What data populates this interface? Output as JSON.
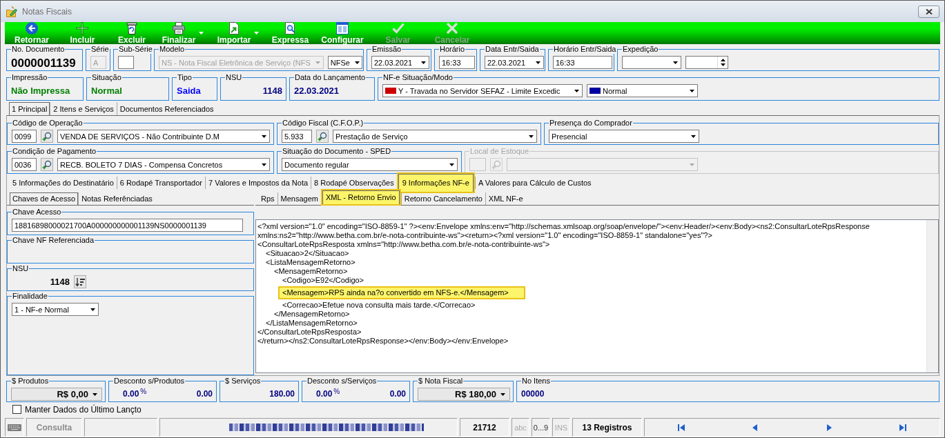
{
  "window": {
    "title": "Notas Fiscais"
  },
  "toolbar": [
    {
      "label": "Retornar",
      "kind": "back",
      "disabled": false,
      "dropdown": false
    },
    {
      "label": "Incluir",
      "kind": "add",
      "disabled": false,
      "dropdown": false
    },
    {
      "label": "Excluir",
      "kind": "delete",
      "disabled": false,
      "dropdown": false
    },
    {
      "label": "Finalizar",
      "kind": "print",
      "disabled": false,
      "dropdown": true
    },
    {
      "label": "Importar",
      "kind": "import",
      "disabled": false,
      "dropdown": true
    },
    {
      "label": "Expressa",
      "kind": "preview",
      "disabled": false,
      "dropdown": false
    },
    {
      "label": "Configurar",
      "kind": "configure",
      "disabled": false,
      "dropdown": false
    },
    {
      "label": "Salvar",
      "kind": "save",
      "disabled": true,
      "dropdown": false
    },
    {
      "label": "Cancelar",
      "kind": "cancel",
      "disabled": true,
      "dropdown": false
    }
  ],
  "header": [
    {
      "label": "No. Documento",
      "fields": [
        {
          "kind": "number",
          "value": "0000001139"
        }
      ]
    },
    {
      "label": "Série",
      "fields": [
        {
          "kind": "input",
          "value": "A",
          "disabled": true
        }
      ]
    },
    {
      "label": "Sub-Série",
      "fields": [
        {
          "kind": "input",
          "disabled": false
        }
      ]
    },
    {
      "label": "Modelo",
      "fields": [
        {
          "kind": "select",
          "value": "NS - Nota Fiscal Eletrônica de Serviço (NFS",
          "disabled": true
        },
        {
          "kind": "select",
          "value": "NFSe",
          "disabled": false
        }
      ]
    },
    {
      "label": "Emissão",
      "fields": [
        {
          "kind": "date",
          "value": "22.03.2021"
        }
      ]
    },
    {
      "label": "Horário",
      "fields": [
        {
          "kind": "input",
          "value": "16:33",
          "disabled": false
        }
      ]
    },
    {
      "label": "Data Entr/Saida",
      "fields": [
        {
          "kind": "date",
          "value": "22.03.2021"
        }
      ]
    },
    {
      "label": "Horário Entr/Saida",
      "fields": [
        {
          "kind": "input",
          "value": "16:33",
          "disabled": false
        }
      ]
    },
    {
      "label": "Expedição",
      "fields": [
        {
          "kind": "select",
          "disabled": false
        },
        {
          "kind": "spin"
        }
      ]
    }
  ],
  "info": [
    {
      "label": "Impressão",
      "fields": [
        {
          "kind": "status",
          "value": "Não Impressa",
          "color": "#008000"
        }
      ]
    },
    {
      "label": "Situação",
      "fields": [
        {
          "kind": "status",
          "value": "Normal",
          "color": "#008000"
        }
      ]
    },
    {
      "label": "Tipo",
      "fields": [
        {
          "kind": "status",
          "value": "Saida",
          "color": "#0000ff"
        }
      ]
    },
    {
      "label": "NSU",
      "fields": [
        {
          "kind": "status",
          "value": "1148",
          "color": "#000080"
        }
      ]
    },
    {
      "label": "Data do Lançamento",
      "fields": [
        {
          "kind": "status",
          "value": "22.03.2021",
          "color": "#000080"
        }
      ]
    },
    {
      "label": "NF-e Situação/Modo",
      "fields": [
        {
          "kind": "flag_select",
          "value": "Y - Travada no Servidor SEFAZ - Limite Excedic",
          "color": "#cc0000"
        },
        {
          "kind": "flag_select",
          "value": "Normal",
          "color": "#0000a0"
        }
      ]
    }
  ],
  "main_tabs": [
    {
      "label": "1 Principal",
      "selected": true
    },
    {
      "label": "2 Itens e Serviços",
      "selected": false
    },
    {
      "label": "Documentos Referenciados",
      "selected": false
    }
  ],
  "principal": [
    [
      {
        "label": "Código de Operação",
        "disabled": false,
        "fields": [
          {
            "kind": "input",
            "value": "0099",
            "disabled": false
          },
          {
            "kind": "search_button",
            "disabled": false
          },
          {
            "kind": "select",
            "value": "VENDA DE SERVIÇOS - Não Contribuinte D.M",
            "disabled": false
          }
        ]
      },
      {
        "label": "Código Fiscal (C.F.O.P.)",
        "disabled": false,
        "fields": [
          {
            "kind": "input",
            "value": "5.933",
            "disabled": false
          },
          {
            "kind": "search_button",
            "disabled": false
          },
          {
            "kind": "select",
            "value": "Prestação de Serviço",
            "disabled": false
          }
        ]
      },
      {
        "label": "Presença do Comprador",
        "disabled": false,
        "fields": [
          {
            "kind": "select",
            "value": "Presencial",
            "disabled": false
          }
        ]
      }
    ],
    [
      {
        "label": "Condição de Pagamento",
        "disabled": false,
        "fields": [
          {
            "kind": "input",
            "value": "0036",
            "disabled": false
          },
          {
            "kind": "search_button",
            "disabled": false
          },
          {
            "kind": "select",
            "value": "RECB. BOLETO 7 DIAS - Compensa Concretos",
            "disabled": false
          }
        ]
      },
      {
        "label": "Situação do Documento - SPED",
        "disabled": false,
        "fields": [
          {
            "kind": "select",
            "value": "Documento regular",
            "disabled": false
          }
        ]
      },
      {
        "label": "Local de Estoque",
        "disabled": true,
        "fields": [
          {
            "kind": "input",
            "disabled": true
          },
          {
            "kind": "search_button",
            "disabled": true
          },
          {
            "kind": "select",
            "disabled": true
          }
        ]
      }
    ]
  ],
  "sub_tabs": [
    {
      "label": "5 Informações do Destinatário",
      "selected": false,
      "highlighted": false
    },
    {
      "label": "6 Rodapé Transportador",
      "selected": false,
      "highlighted": false
    },
    {
      "label": "7 Valores e Impostos da Nota",
      "selected": false,
      "highlighted": false
    },
    {
      "label": "8 Rodapé Observações",
      "selected": false,
      "highlighted": false
    },
    {
      "label": "9 Informações NF-e",
      "selected": true,
      "highlighted": true
    },
    {
      "label": "A Valores para Cálculo de Custos",
      "selected": false,
      "highlighted": false
    }
  ],
  "detail": {
    "tabs": [
      {
        "label": "Chaves de Acesso",
        "selected": true
      },
      {
        "label": "Notas Referênciadas",
        "selected": false
      }
    ],
    "groups": [
      {
        "label": "Chave Acesso",
        "fields": [
          {
            "kind": "input",
            "value": "18816898000021700A000000000001139NS0000001139",
            "disabled": false
          }
        ]
      },
      {
        "label": "Chave NF Referenciada"
      },
      {
        "label": "NSU",
        "fields": [
          {
            "kind": "value",
            "value": "1148"
          },
          {
            "kind": "sort_button"
          }
        ]
      },
      {
        "label": "Finalidade",
        "fields": [
          {
            "kind": "select",
            "value": "1 - NF-e Normal",
            "disabled": false
          }
        ]
      }
    ]
  },
  "xml": {
    "tabs": [
      {
        "label": "Rps",
        "selected": false,
        "highlighted": false
      },
      {
        "label": "Mensagem",
        "selected": false,
        "highlighted": false
      },
      {
        "label": "XML - Retorno Envio",
        "selected": true,
        "highlighted": true
      },
      {
        "label": "Retorno Cancelamento",
        "selected": false,
        "highlighted": false
      },
      {
        "label": "XML NF-e",
        "selected": false,
        "highlighted": false
      }
    ],
    "lines": [
      {
        "text": "<?xml version=\"1.0\" encoding=\"ISO-8859-1\" ?><env:Envelope xmlns:env=\"http://schemas.xmlsoap.org/soap/envelope/\"><env:Header/><env:Body><ns2:ConsultarLoteRpsResponse",
        "highlighted": false
      },
      {
        "text": "xmlns:ns2=\"http://www.betha.com.br/e-nota-contribuinte-ws\"><return><?xml version=\"1.0\" encoding=\"ISO-8859-1\" standalone=\"yes\"?>",
        "highlighted": false
      },
      {
        "text": "<ConsultarLoteRpsResposta xmlns=\"http://www.betha.com.br/e-nota-contribuinte-ws\">",
        "highlighted": false,
        "children": [
          {
            "text": "<Situacao>2</Situacao>",
            "highlighted": false
          },
          {
            "text": "<ListaMensagemRetorno>",
            "highlighted": false,
            "children": [
              {
                "text": "<MensagemRetorno>",
                "highlighted": false,
                "children": [
                  {
                    "text": "<Codigo>E92</Codigo>",
                    "highlighted": false
                  },
                  {
                    "text": "<Mensagem>RPS ainda na?o convertido em NFS-e.</Mensagem>",
                    "highlighted": true
                  },
                  {
                    "text": "<Correcao>Efetue nova consulta mais tarde.</Correcao>",
                    "highlighted": false
                  }
                ]
              },
              {
                "text": "</MensagemRetorno>",
                "highlighted": false
              }
            ]
          },
          {
            "text": "</ListaMensagemRetorno>",
            "highlighted": false
          }
        ]
      },
      {
        "text": "</ConsultarLoteRpsResposta>",
        "highlighted": false
      },
      {
        "text": "</return></ns2:ConsultarLoteRpsResponse></env:Body></env:Envelope>",
        "highlighted": false
      }
    ]
  },
  "totals": [
    {
      "label": "$ Produtos",
      "fields": [
        {
          "kind": "money_select",
          "value": "R$ 0,00"
        }
      ]
    },
    {
      "label": "Desconto s/Produtos",
      "fields": [
        {
          "kind": "percent",
          "value": "0.00",
          "unit": "%"
        },
        {
          "kind": "amount",
          "value": "0.00"
        }
      ]
    },
    {
      "label": "$ Serviços",
      "fields": [
        {
          "kind": "amount",
          "value": "180.00"
        }
      ]
    },
    {
      "label": "Desconto s/Serviços",
      "fields": [
        {
          "kind": "percent",
          "value": "0.00",
          "unit": "%"
        },
        {
          "kind": "amount",
          "value": "0.00"
        }
      ]
    },
    {
      "label": "$ Nota Fiscal",
      "fields": [
        {
          "kind": "money_select",
          "value": "R$ 180,00"
        }
      ]
    },
    {
      "label": "No Itens",
      "fields": [
        {
          "kind": "amount",
          "value": "00000"
        }
      ]
    }
  ],
  "keep_data": {
    "label": "Manter Dados do Último Lançto",
    "checked": false
  },
  "status_bar": {
    "mode": "Consulta",
    "code": "21712",
    "indicators": [
      {
        "label": "abc",
        "on": false
      },
      {
        "label": "0...9",
        "on": true
      },
      {
        "label": "INS",
        "on": false
      }
    ],
    "records": "13 Registros"
  }
}
